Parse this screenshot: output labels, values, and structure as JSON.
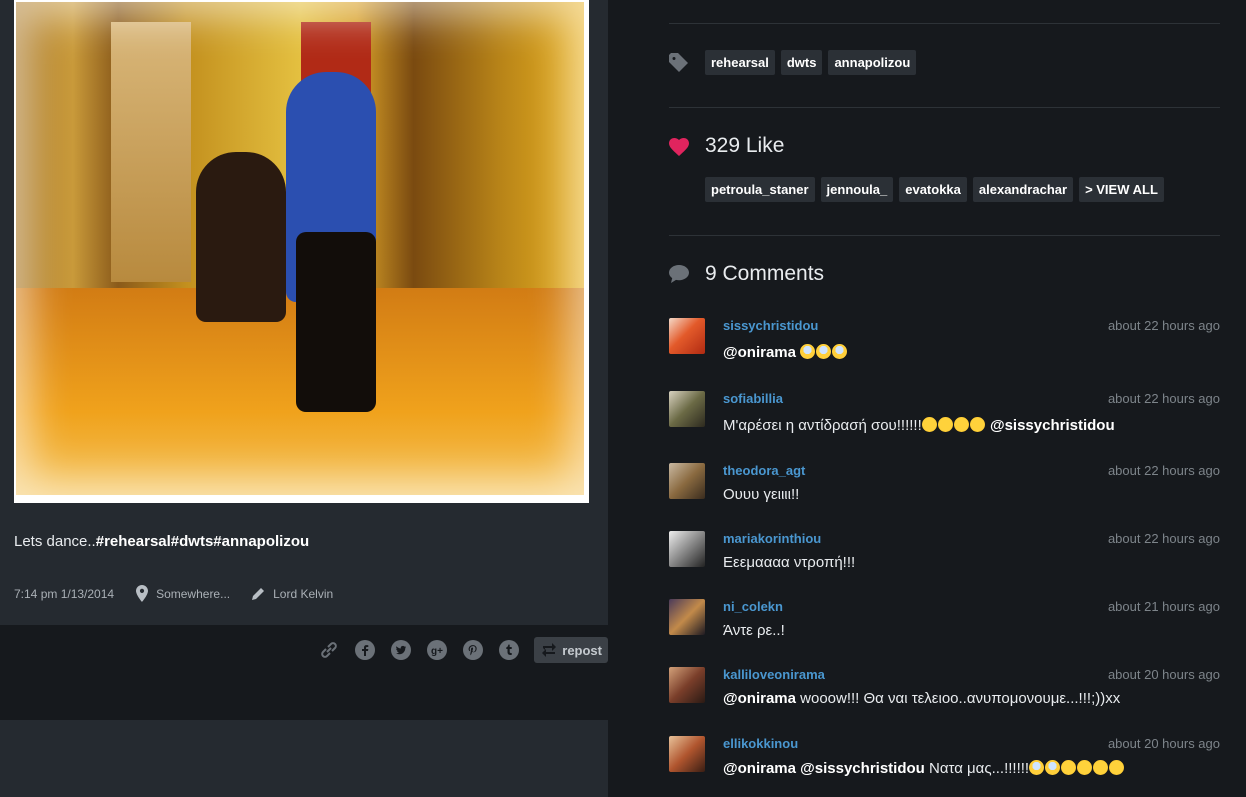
{
  "post": {
    "caption_prefix": "Lets dance..",
    "caption_tags": "#rehearsal#dwts#annapolizou",
    "datetime": "7:14 pm 1/13/2014",
    "location": "Somewhere...",
    "author": "Lord Kelvin",
    "repost_label": "repost"
  },
  "tags": [
    "rehearsal",
    "dwts",
    "annapolizou"
  ],
  "likes": {
    "title": "329 Like",
    "users": [
      "petroula_staner",
      "jennoula_",
      "evatokka",
      "alexandrachar",
      "> VIEW ALL"
    ]
  },
  "comments_title": "9 Comments",
  "comments": [
    {
      "user": "sissychristidou",
      "time": "about 22 hours ago",
      "mention": "@onirama",
      "text": ""
    },
    {
      "user": "sofiabillia",
      "time": "about 22 hours ago",
      "mention": "",
      "text": "Μ'αρέσει η αντίδρασή σου!!!!!!",
      "mention2": "@sissychristidou"
    },
    {
      "user": "theodora_agt",
      "time": "about 22 hours ago",
      "mention": "",
      "text": "Ουυυ γειιιι!!"
    },
    {
      "user": "mariakorinthiou",
      "time": "about 22 hours ago",
      "mention": "",
      "text": "Εεεμαααα ντροπή!!!"
    },
    {
      "user": "ni_colekn",
      "time": "about 21 hours ago",
      "mention": "",
      "text": "Άντε ρε..!"
    },
    {
      "user": "kalliloveonirama",
      "time": "about 20 hours ago",
      "mention": "@onirama",
      "text": " wooow!!! Θα ναι τελειοο..ανυπομονουμε...!!!;))xx"
    },
    {
      "user": "ellikokkinou",
      "time": "about 20 hours ago",
      "mention": "@onirama @sissychristidou",
      "text": " Νατα μας...!!!!!!"
    }
  ],
  "colors": {
    "accent_link": "#4a97d0",
    "heart": "#e0245e",
    "bg": "#16191d",
    "card": "#252a30"
  },
  "icons": [
    "tag-icon",
    "heart-icon",
    "comment-icon",
    "location-pin-icon",
    "pencil-icon",
    "link-icon",
    "facebook-icon",
    "twitter-icon",
    "google-plus-icon",
    "pinterest-icon",
    "tumblr-icon",
    "repost-icon"
  ]
}
